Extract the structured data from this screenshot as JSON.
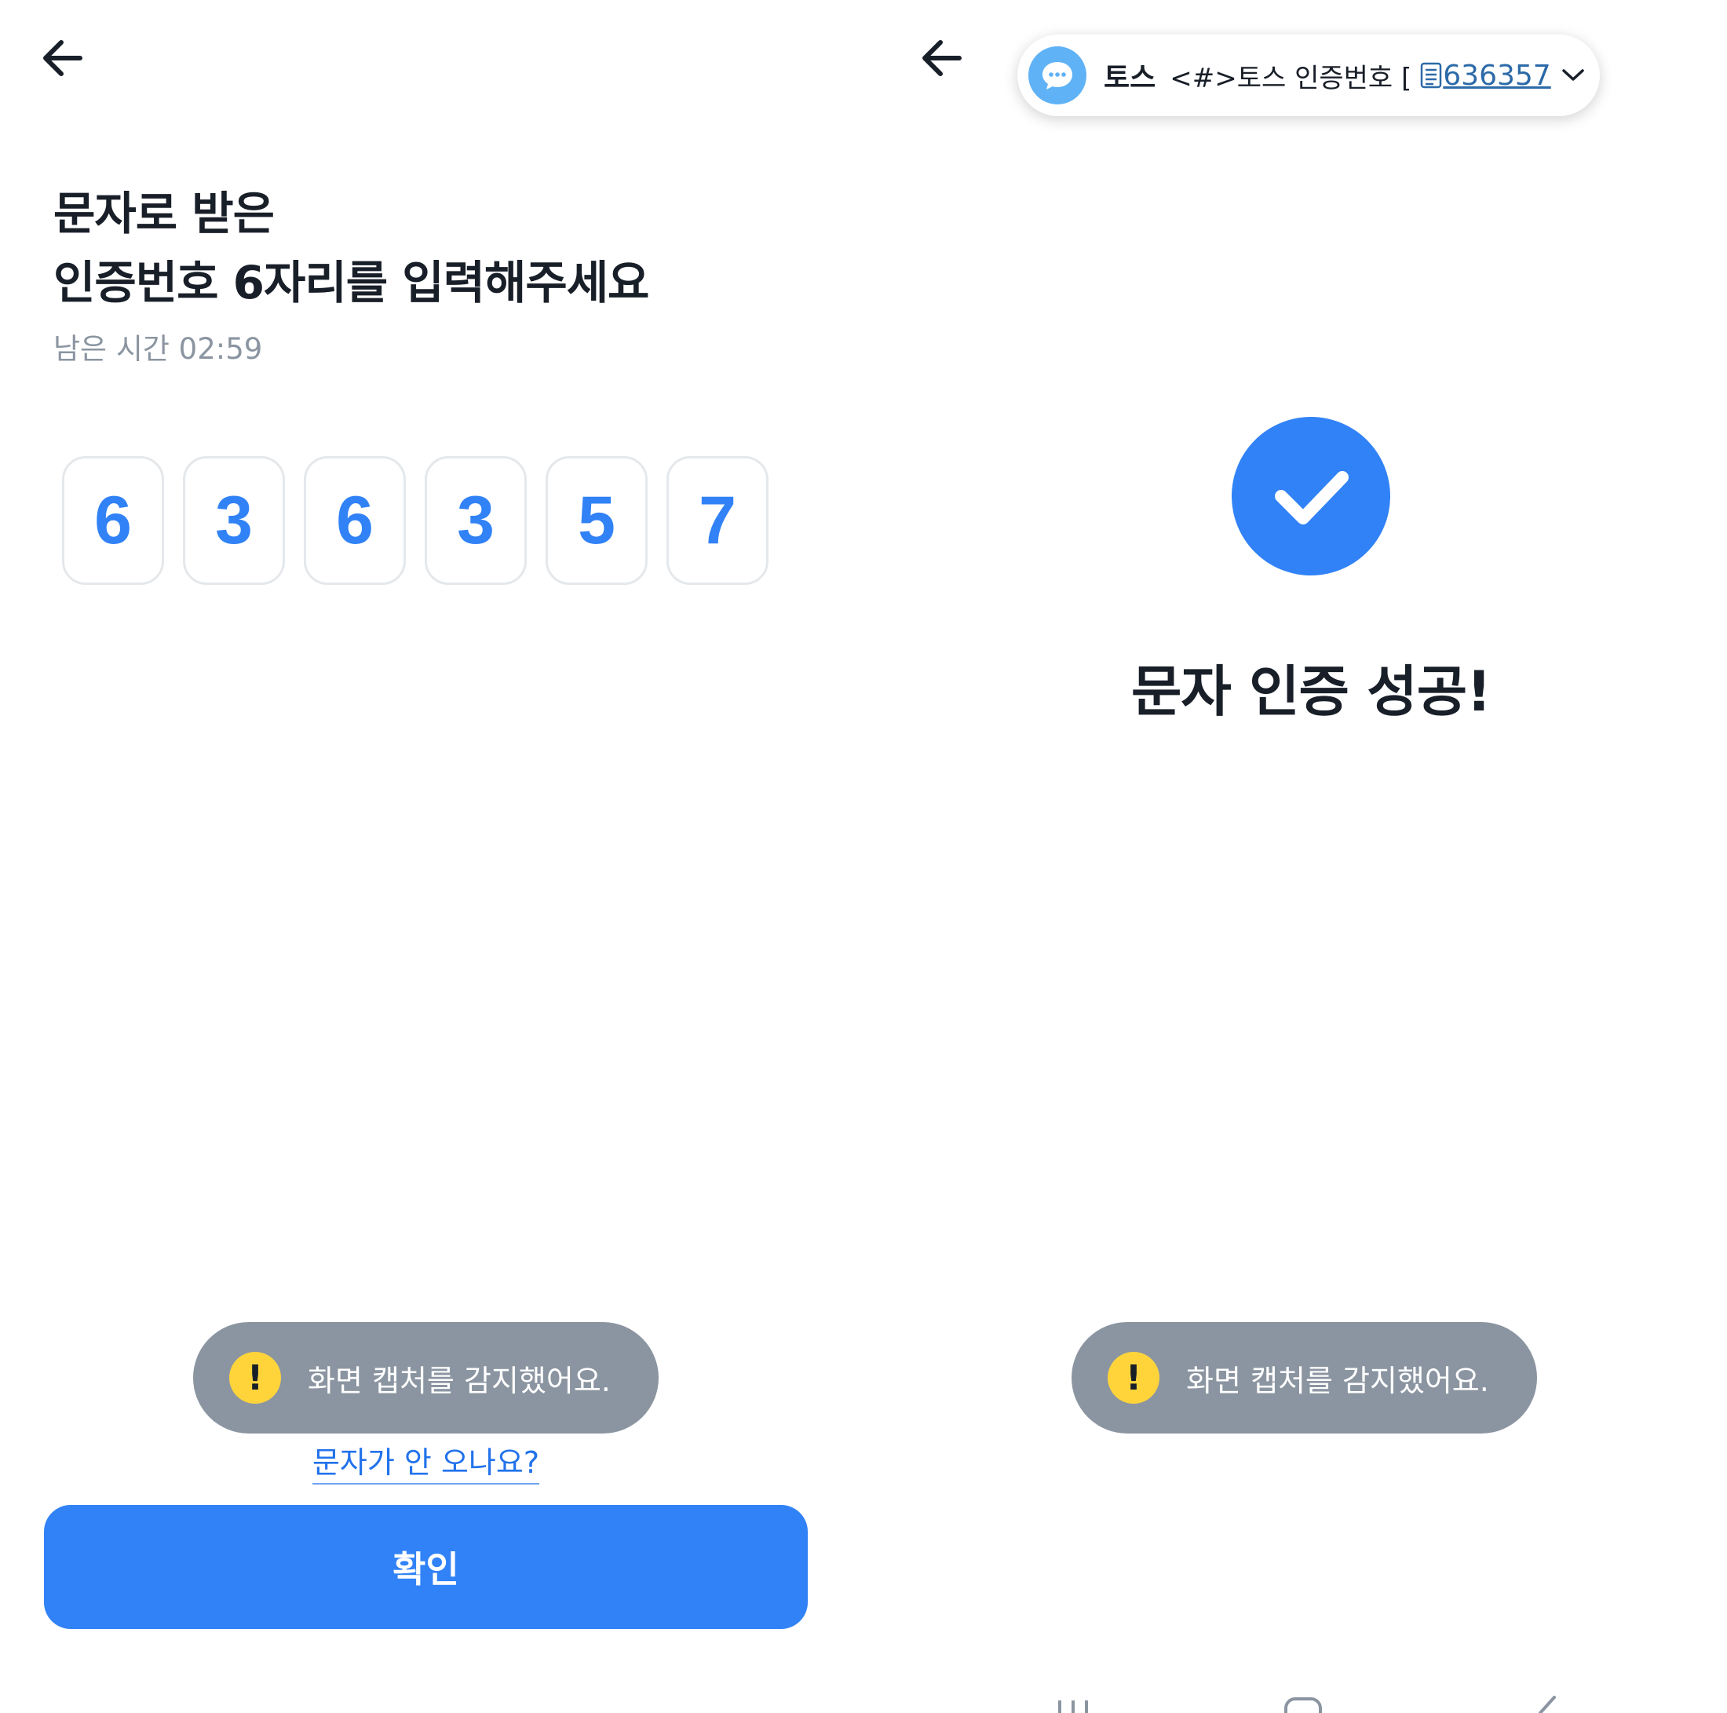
{
  "left_screen": {
    "back_icon": "arrow-left-icon",
    "title_line1": "문자로 받은",
    "title_line2": "인증번호 6자리를 입력해주세요",
    "timer_text": "남은 시간 02:59",
    "digits": [
      "6",
      "3",
      "6",
      "3",
      "5",
      "7"
    ],
    "toast": {
      "icon": "warning-icon",
      "text": "화면 캡처를 감지했어요."
    },
    "no_sms_link": "문자가 안 오나요?",
    "confirm_label": "확인"
  },
  "right_screen": {
    "back_icon": "arrow-left-icon",
    "sms_notification": {
      "icon": "message-icon",
      "sender": "토스",
      "body": "<#>토스 인증번호 [",
      "code": "636357",
      "expand_icon": "chevron-down-icon"
    },
    "success_icon": "check-icon",
    "success_title": "문자 인증 성공!",
    "toast": {
      "icon": "warning-icon",
      "text": "화면 캡처를 감지했어요."
    }
  },
  "colors": {
    "primary": "#3182f6",
    "text": "#191f28",
    "subtext": "#8b95a1",
    "toast_bg": "#8b95a1",
    "warning": "#ffd43b",
    "border": "#e5e8eb"
  }
}
